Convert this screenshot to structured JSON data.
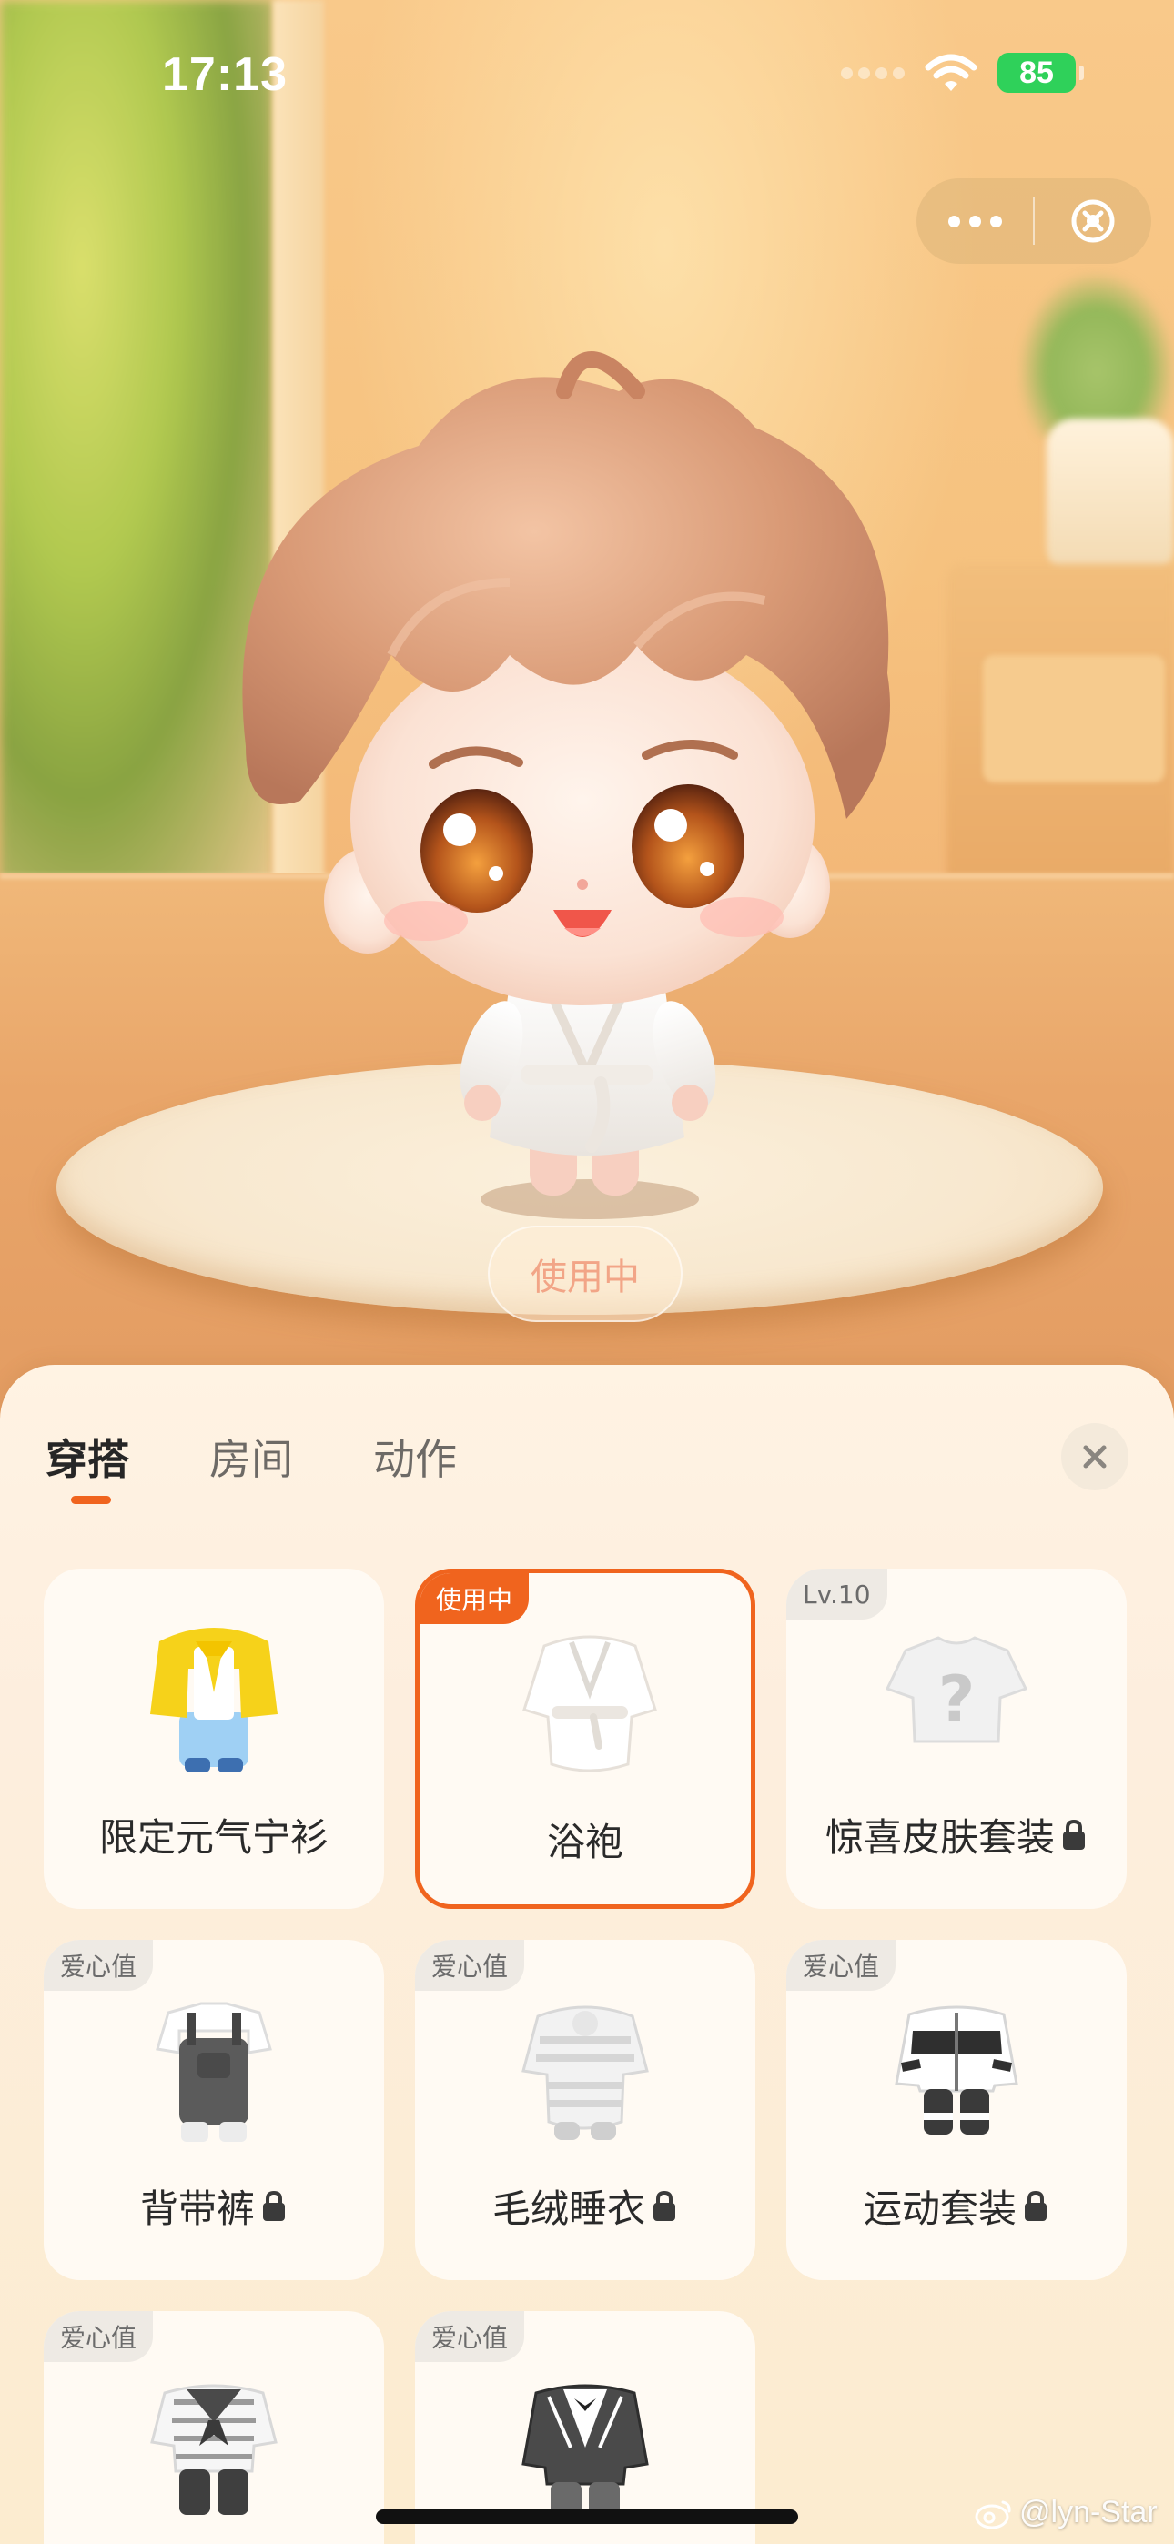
{
  "status_bar": {
    "time": "17:13",
    "battery": "85"
  },
  "scene": {
    "in_use_label": "使用中"
  },
  "panel": {
    "tabs": [
      {
        "label": "穿搭",
        "active": true
      },
      {
        "label": "房间",
        "active": false
      },
      {
        "label": "动作",
        "active": false
      }
    ],
    "items": [
      {
        "name": "限定元气宁衫",
        "badge": "",
        "locked": false,
        "selected": false,
        "icon": "yellow-jacket-outfit"
      },
      {
        "name": "浴袍",
        "badge": "使用中",
        "locked": false,
        "selected": true,
        "icon": "white-bathrobe"
      },
      {
        "name": "惊喜皮肤套装",
        "badge": "Lv.10",
        "locked": true,
        "selected": false,
        "icon": "mystery-shirt"
      },
      {
        "name": "背带裤",
        "badge": "爱心值",
        "locked": true,
        "selected": false,
        "icon": "overalls"
      },
      {
        "name": "毛绒睡衣",
        "badge": "爱心值",
        "locked": true,
        "selected": false,
        "icon": "plush-pajamas"
      },
      {
        "name": "运动套装",
        "badge": "爱心值",
        "locked": true,
        "selected": false,
        "icon": "tracksuit"
      },
      {
        "name": "",
        "badge": "爱心值",
        "locked": true,
        "selected": false,
        "icon": "sailor-suit"
      },
      {
        "name": "",
        "badge": "爱心值",
        "locked": true,
        "selected": false,
        "icon": "school-suit"
      }
    ]
  },
  "watermark": "@lyn-Star",
  "colors": {
    "accent": "#f0641e",
    "battery": "#2fd15a"
  }
}
